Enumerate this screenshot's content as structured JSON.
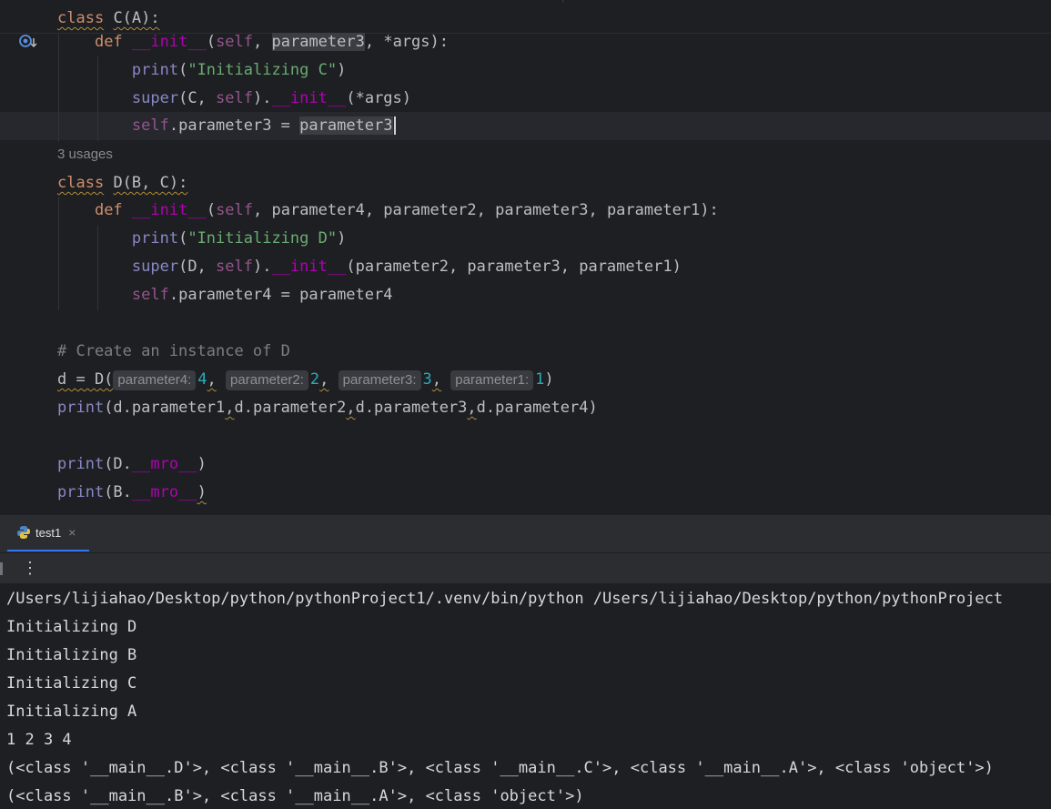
{
  "editor": {
    "lines": [
      {
        "segments": [
          [
            "class",
            "kw squig"
          ],
          [
            " ",
            "plain"
          ],
          [
            "C(A):",
            "plain squig"
          ]
        ]
      },
      {
        "segments": [
          [
            "    ",
            "plain"
          ],
          [
            "def",
            "kw"
          ],
          [
            " ",
            "plain"
          ],
          [
            "__init__",
            "dunder"
          ],
          [
            "(",
            "plain"
          ],
          [
            "self",
            "self"
          ],
          [
            ", ",
            "plain"
          ],
          [
            "parameter3",
            "plain param-hl"
          ],
          [
            ", *args):",
            "plain"
          ]
        ]
      },
      {
        "segments": [
          [
            "        ",
            "plain"
          ],
          [
            "print",
            "bi"
          ],
          [
            "(",
            "plain"
          ],
          [
            "\"Initializing C\"",
            "str"
          ],
          [
            ")",
            "plain"
          ]
        ]
      },
      {
        "segments": [
          [
            "        ",
            "plain"
          ],
          [
            "super",
            "bi"
          ],
          [
            "(C, ",
            "plain"
          ],
          [
            "self",
            "self"
          ],
          [
            ").",
            "plain"
          ],
          [
            "__init__",
            "dunder"
          ],
          [
            "(*args)",
            "plain"
          ]
        ]
      },
      {
        "segments": [
          [
            "        ",
            "plain"
          ],
          [
            "self",
            "self"
          ],
          [
            ".parameter3 = ",
            "plain"
          ],
          [
            "parameter3",
            "plain param-hl"
          ]
        ]
      },
      {
        "segments": []
      },
      {
        "segments": [
          [
            "class",
            "kw squig"
          ],
          [
            " ",
            "plain"
          ],
          [
            "D(B, C):",
            "plain squig"
          ]
        ]
      },
      {
        "segments": [
          [
            "    ",
            "plain"
          ],
          [
            "def",
            "kw"
          ],
          [
            " ",
            "plain"
          ],
          [
            "__init__",
            "dunder"
          ],
          [
            "(",
            "plain"
          ],
          [
            "self",
            "self"
          ],
          [
            ", parameter4, parameter2, parameter3, parameter1):",
            "plain"
          ]
        ]
      },
      {
        "segments": [
          [
            "        ",
            "plain"
          ],
          [
            "print",
            "bi"
          ],
          [
            "(",
            "plain"
          ],
          [
            "\"Initializing D\"",
            "str"
          ],
          [
            ")",
            "plain"
          ]
        ]
      },
      {
        "segments": [
          [
            "        ",
            "plain"
          ],
          [
            "super",
            "bi"
          ],
          [
            "(D, ",
            "plain"
          ],
          [
            "self",
            "self"
          ],
          [
            ").",
            "plain"
          ],
          [
            "__init__",
            "dunder"
          ],
          [
            "(parameter2, parameter3, parameter1)",
            "plain"
          ]
        ]
      },
      {
        "segments": [
          [
            "        ",
            "plain"
          ],
          [
            "self",
            "self"
          ],
          [
            ".parameter4 = parameter4",
            "plain"
          ]
        ]
      },
      {
        "segments": []
      },
      {
        "segments": [
          [
            "# Create an instance of D",
            "cmt"
          ]
        ]
      },
      {
        "segments": [
          [
            "d = D(",
            "plain squig"
          ],
          [
            "parameter4:",
            "hint"
          ],
          [
            "4",
            "num"
          ],
          [
            ",",
            "plain squig"
          ],
          [
            " ",
            "plain"
          ],
          [
            "parameter2:",
            "hint"
          ],
          [
            "2",
            "num"
          ],
          [
            ",",
            "plain squig"
          ],
          [
            " ",
            "plain"
          ],
          [
            "parameter3:",
            "hint"
          ],
          [
            "3",
            "num"
          ],
          [
            ",",
            "plain squig"
          ],
          [
            " ",
            "plain"
          ],
          [
            "parameter1:",
            "hint"
          ],
          [
            "1",
            "num"
          ],
          [
            ")",
            "plain"
          ]
        ]
      },
      {
        "segments": [
          [
            "print",
            "bi"
          ],
          [
            "(d.parameter1",
            "plain"
          ],
          [
            ",",
            "plain squig"
          ],
          [
            "d.parameter2",
            "plain"
          ],
          [
            ",",
            "plain squig"
          ],
          [
            "d.parameter3",
            "plain"
          ],
          [
            ",",
            "plain squig"
          ],
          [
            "d.parameter4)",
            "plain"
          ]
        ]
      },
      {
        "segments": []
      },
      {
        "segments": [
          [
            "print",
            "bi"
          ],
          [
            "(D.",
            "plain"
          ],
          [
            "__mro__",
            "dunder"
          ],
          [
            ")",
            "plain"
          ]
        ]
      },
      {
        "segments": [
          [
            "print",
            "bi"
          ],
          [
            "(B.",
            "plain"
          ],
          [
            "__mro__",
            "dunder"
          ],
          [
            ")",
            "plain squig"
          ]
        ]
      }
    ],
    "usages_hint": "3 usages"
  },
  "run_panel": {
    "tab_label": "test1",
    "tab_close": "×",
    "more_actions": "⋮"
  },
  "console": {
    "lines": [
      "/Users/lijiahao/Desktop/python/pythonProject1/.venv/bin/python /Users/lijiahao/Desktop/python/pythonProject",
      "Initializing D",
      "Initializing B",
      "Initializing C",
      "Initializing A",
      "1 2 3 4",
      "(<class '__main__.D'>, <class '__main__.B'>, <class '__main__.C'>, <class '__main__.A'>, <class 'object'>)",
      "(<class '__main__.B'>, <class '__main__.A'>, <class 'object'>)"
    ]
  },
  "colors": {
    "keyword": "#cf8e6d",
    "self": "#94558d",
    "builtin": "#8888c6",
    "dunder": "#b200b2",
    "string": "#6aab73",
    "comment": "#7a7e85",
    "number": "#2aacb8",
    "accent": "#3574f0"
  }
}
